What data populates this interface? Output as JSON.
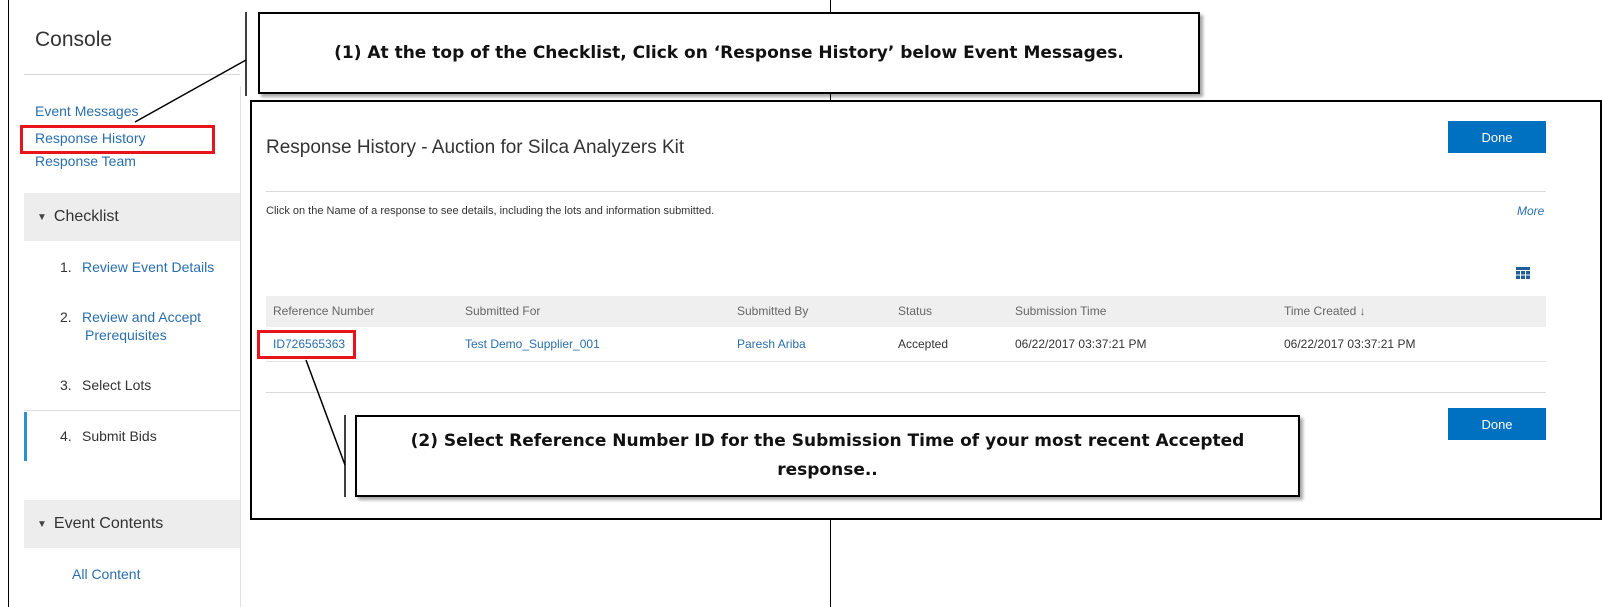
{
  "console": {
    "title": "Console",
    "links": [
      "Event Messages",
      "Response History",
      "Response Team"
    ],
    "checklist": {
      "heading": "Checklist",
      "steps": [
        {
          "num": "1.",
          "label": "Review Event Details"
        },
        {
          "num": "2.",
          "label": "Review and Accept",
          "label2": "Prerequisites"
        },
        {
          "num": "3.",
          "label": "Select Lots"
        },
        {
          "num": "4.",
          "label": "Submit Bids"
        }
      ]
    },
    "event_contents": {
      "heading": "Event Contents",
      "items": [
        "All Content"
      ]
    }
  },
  "dialog": {
    "title": "Response History - Auction for Silca Analyzers Kit",
    "done_label": "Done",
    "description": "Click on the Name of a response to see details, including the lots and information submitted.",
    "more_label": "More",
    "table": {
      "columns": [
        "Reference Number",
        "Submitted For",
        "Submitted By",
        "Status",
        "Submission Time",
        "Time Created ↓"
      ],
      "rows": [
        {
          "reference_number": "ID726565363",
          "submitted_for": "Test Demo_Supplier_001",
          "submitted_by": "Paresh Ariba",
          "status": "Accepted",
          "submission_time": "06/22/2017 03:37:21 PM",
          "time_created": "06/22/2017 03:37:21 PM"
        }
      ]
    }
  },
  "annotations": {
    "step1": "(1) At the top of the Checklist, Click on ‘Response History’ below Event Messages.",
    "step2": "(2) Select Reference Number ID for the Submission Time of your most recent Accepted response.."
  },
  "colors": {
    "link": "#2a6ead",
    "button": "#0070c0",
    "highlight": "#e8141b"
  }
}
